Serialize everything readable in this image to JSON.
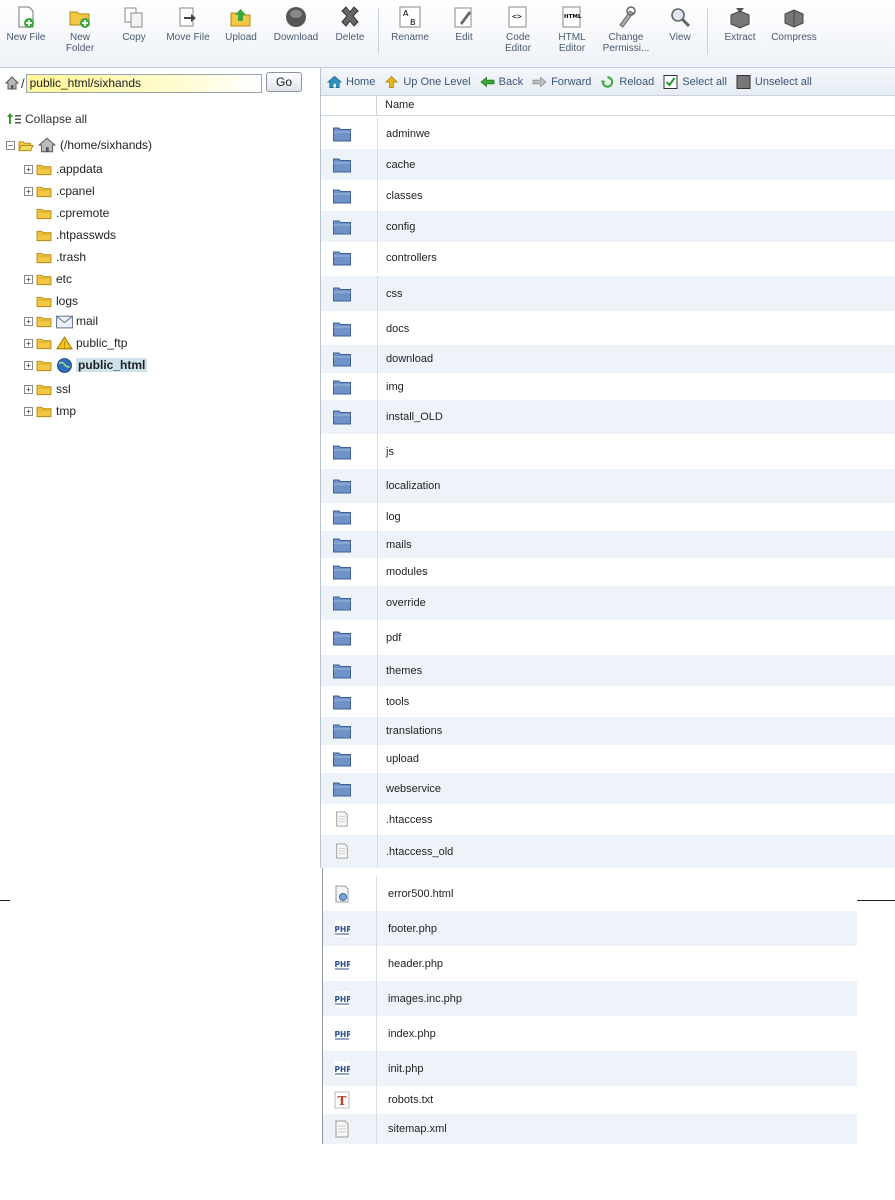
{
  "toolbar": {
    "buttons": [
      {
        "label": "New File",
        "icon": "new-file-icon"
      },
      {
        "label": "New\nFolder",
        "icon": "new-folder-icon"
      },
      {
        "label": "Copy",
        "icon": "copy-icon"
      },
      {
        "label": "Move File",
        "icon": "move-file-icon"
      },
      {
        "label": "Upload",
        "icon": "upload-icon"
      },
      {
        "label": "Download",
        "icon": "download-icon"
      },
      {
        "label": "Delete",
        "icon": "delete-icon"
      },
      {
        "label": "Rename",
        "icon": "rename-icon"
      },
      {
        "label": "Edit",
        "icon": "edit-icon"
      },
      {
        "label": "Code\nEditor",
        "icon": "code-editor-icon"
      },
      {
        "label": "HTML\nEditor",
        "icon": "html-editor-icon"
      },
      {
        "label": "Change\nPermissi...",
        "icon": "permissions-icon"
      },
      {
        "label": "View",
        "icon": "view-icon"
      },
      {
        "label": "Extract",
        "icon": "extract-icon"
      },
      {
        "label": "Compress",
        "icon": "compress-icon"
      }
    ]
  },
  "path": {
    "slash": "/",
    "value": "public_html/sixhands",
    "go_label": "Go"
  },
  "tree": {
    "collapse_label": "Collapse all",
    "root": "(/home/sixhands)",
    "nodes": [
      {
        "label": ".appdata",
        "expandable": true
      },
      {
        "label": ".cpanel",
        "expandable": true
      },
      {
        "label": ".cpremote",
        "expandable": false
      },
      {
        "label": ".htpasswds",
        "expandable": false
      },
      {
        "label": ".trash",
        "expandable": false
      },
      {
        "label": "etc",
        "expandable": true
      },
      {
        "label": "logs",
        "expandable": false
      },
      {
        "label": "mail",
        "expandable": true
      },
      {
        "label": "public_ftp",
        "expandable": true
      },
      {
        "label": "public_html",
        "expandable": true,
        "selected": true
      },
      {
        "label": "ssl",
        "expandable": true
      },
      {
        "label": "tmp",
        "expandable": true
      }
    ]
  },
  "nav": {
    "home": "Home",
    "up": "Up One Level",
    "back": "Back",
    "forward": "Forward",
    "reload": "Reload",
    "select_all": "Select all",
    "unselect_all": "Unselect all"
  },
  "list": {
    "header_name": "Name",
    "folders": [
      "adminwe",
      "cache",
      "classes",
      "config",
      "controllers",
      "css",
      "docs",
      "download",
      "img",
      "install_OLD",
      "js",
      "localization",
      "log",
      "mails",
      "modules",
      "override",
      "pdf",
      "themes",
      "tools",
      "translations",
      "upload",
      "webservice"
    ],
    "upper_files": [
      ".htaccess",
      ".htaccess_old"
    ],
    "lower_files": [
      {
        "name": "error500.html",
        "icon": "html-file-icon"
      },
      {
        "name": "footer.php",
        "icon": "php-file-icon"
      },
      {
        "name": "header.php",
        "icon": "php-file-icon"
      },
      {
        "name": "images.inc.php",
        "icon": "php-file-icon"
      },
      {
        "name": "index.php",
        "icon": "php-file-icon"
      },
      {
        "name": "init.php",
        "icon": "php-file-icon"
      },
      {
        "name": "robots.txt",
        "icon": "text-file-icon"
      },
      {
        "name": "sitemap.xml",
        "icon": "generic-file-icon"
      }
    ]
  },
  "colors": {
    "alt_row": "#eef3fa",
    "selected_tree": "#cde2ea",
    "folder_blue": "#6f93c8",
    "folder_yellow": "#f2c744"
  }
}
